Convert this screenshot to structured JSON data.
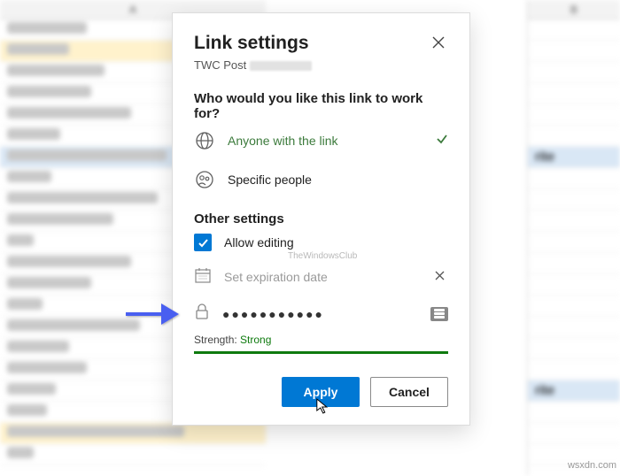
{
  "background": {
    "column_a_header": "A",
    "column_b_header": "B",
    "visible_text_fragments": [
      "rite",
      "rite"
    ]
  },
  "dialog": {
    "title": "Link settings",
    "file_name": "TWC Post",
    "subtitle": "Who would you like this link to work for?",
    "options": {
      "anyone": {
        "label": "Anyone with the link",
        "selected": true
      },
      "specific": {
        "label": "Specific people",
        "selected": false
      }
    },
    "other_settings_title": "Other settings",
    "allow_editing": {
      "label": "Allow editing",
      "checked": true
    },
    "expiration": {
      "placeholder": "Set expiration date",
      "value": ""
    },
    "password": {
      "value_masked": "●●●●●●●●●●●",
      "strength_label": "Strength:",
      "strength_value": "Strong"
    },
    "buttons": {
      "apply": "Apply",
      "cancel": "Cancel"
    }
  },
  "watermark_inline": "TheWindowsClub",
  "watermark_corner": "wsxdn.com"
}
